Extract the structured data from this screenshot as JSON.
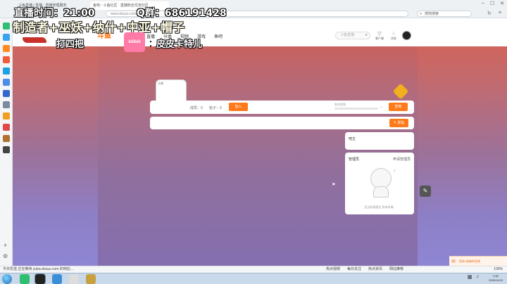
{
  "browser": {
    "tabs": [
      {
        "label": "斗鱼直播 | 直播 · 直播管理服务"
      },
      {
        "label": "鱼吧 - 斗鱼社区 · 直播粉丝交流社区"
      }
    ],
    "url": "www.douyu.com/gro...",
    "search_placeholder": "搜狗搜索",
    "status_text": "今日优选   正在等待 yuba.douyu.com 的响应...",
    "status_items": [
      "热点视频",
      "每日关注",
      "热点资讯",
      "网站推荐"
    ],
    "zoom": "100%"
  },
  "overlay": {
    "stream_time": "直播时间：21:00",
    "qq_group": "Q群：686191428",
    "credits": "制造者+巫妖+纳什+中亚+帽子",
    "play_label": "打四把",
    "bili_badge": "bilibili",
    "bili_colon": "：",
    "streamer_name": "皮皮卡特儿"
  },
  "site": {
    "logo_text": "斗鱼",
    "nav": [
      "直播",
      "分类",
      "视频",
      "游戏",
      "鱼吧"
    ],
    "search_placeholder": "斗鱼直播",
    "header_icons": [
      {
        "label": "客户端",
        "icon": "gift-icon"
      },
      {
        "label": "消息",
        "icon": "bell-icon"
      }
    ]
  },
  "forum": {
    "avatar_alt": "头像",
    "posts_stat": "成员：0",
    "topics_stat": "帖子：0",
    "join_label": "加入",
    "progress_label": "发布签到",
    "progress_value": 0.0,
    "signin_label": "签到",
    "post_label": "发帖",
    "owner_title": "吧主",
    "admins_title": "管理员",
    "apply_admin": "申请管理员",
    "empty_text": "还没有管理员 快来申请~",
    "toast_text": "您有1条新的消息"
  },
  "taskbar": {
    "time": "0:52",
    "date": "2020/11/23"
  }
}
